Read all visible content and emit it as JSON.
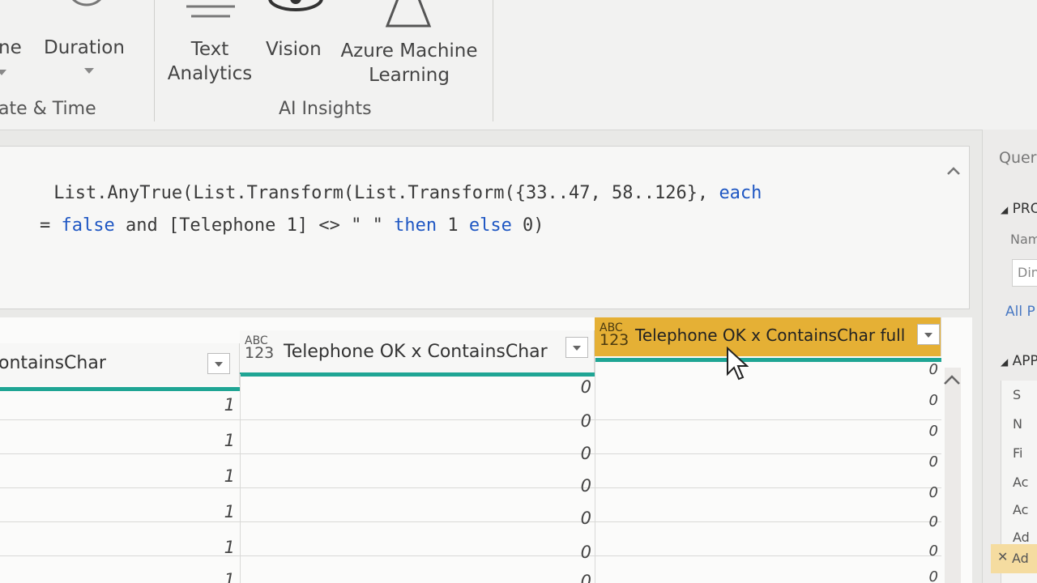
{
  "ribbon": {
    "items": [
      {
        "label": "ne"
      },
      {
        "label": "Duration"
      },
      {
        "label": "Text\nAnalytics"
      },
      {
        "label": "Vision"
      },
      {
        "label": "Azure Machine\nLearning"
      }
    ],
    "groups": {
      "date_time": "ate & Time",
      "ai_insights": "AI Insights"
    }
  },
  "formula": {
    "line1_a": " List.AnyTrue(List.Transform(List.Transform({33..47, 58..126}, ",
    "line1_kw": "each",
    "line2_pre": "= ",
    "line2_false": "false",
    "line2_mid": " and [Telephone 1] <> \" \" ",
    "line2_then": "then",
    "line2_one": " 1 ",
    "line2_else": "else",
    "line2_end": " 0)"
  },
  "grid": {
    "columns": [
      {
        "name": "ontainsChar",
        "type_top": "",
        "type_bottom": ""
      },
      {
        "name": "Telephone OK x ContainsChar",
        "type_top": "ABC",
        "type_bottom": "123"
      },
      {
        "name": "Telephone OK x ContainsChar full",
        "type_top": "ABC",
        "type_bottom": "123"
      }
    ],
    "col1_values": [
      "1",
      "1",
      "1",
      "1",
      "1",
      "1"
    ],
    "col2_values": [
      "0",
      "0",
      "0",
      "0",
      "0",
      "0",
      "0"
    ],
    "col3_values": [
      "0",
      "0",
      "0",
      "0",
      "0",
      "0",
      "0",
      "0"
    ]
  },
  "right_pane": {
    "title": "Quer",
    "properties": "PRO",
    "name_label": "Nam",
    "name_value": "Din",
    "all_props": "All P",
    "applied": "APPL",
    "steps": [
      "S",
      "N",
      "Fi",
      "Ac",
      "Ac",
      "Ad",
      "Ad"
    ]
  },
  "colors": {
    "selected_header": "#e5b035",
    "teal": "#1fa594",
    "keyword": "#1f57c3"
  }
}
